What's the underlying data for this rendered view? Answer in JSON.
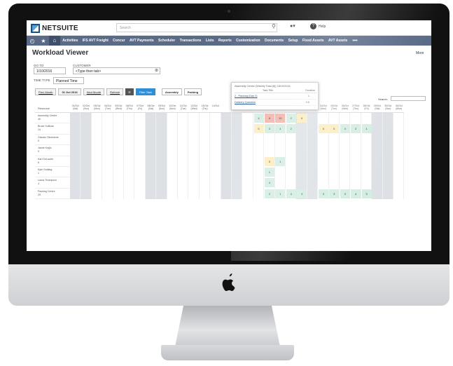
{
  "brand": {
    "name": "NETSUITE"
  },
  "search": {
    "placeholder": "Search"
  },
  "topbar": {
    "help": "Help"
  },
  "nav": {
    "items": [
      "Activities",
      "IFS AVT Freight",
      "Concur",
      "AVT Payments",
      "Scheduler",
      "Transactions",
      "Lists",
      "Reports",
      "Customization",
      "Documents",
      "Setup",
      "Fixed Assets",
      "AVT Assets"
    ],
    "more": "•••"
  },
  "page": {
    "title": "Workload Viewer",
    "more": "More"
  },
  "form": {
    "goto_label": "GO TO",
    "goto_value": "1/10/2016",
    "customer_label": "CUSTOMER",
    "customer_value": "<Type then tab>",
    "timetype_label": "TIME TYPE",
    "timetype_value": "Planned Time"
  },
  "toolbar": {
    "prev": "Prev Month",
    "current": "01 Oct 2016",
    "next": "Next Month",
    "refresh": "Refresh",
    "filter": "Filter Task",
    "assembly": "Assembly",
    "packing": "Packing"
  },
  "grid": {
    "search_label": "Search:",
    "resource_header": "Resource",
    "resources": [
      {
        "name": "Assembly Centre",
        "count": "40"
      },
      {
        "name": "Bruce Sullivan",
        "count": "14"
      },
      {
        "name": "Glaucio Silvestone",
        "count": "0"
      },
      {
        "name": "Jamie Krajic",
        "count": "0"
      },
      {
        "name": "Karl DeLauter",
        "count": "6"
      },
      {
        "name": "Kyle Golding",
        "count": "1"
      },
      {
        "name": "Laura Thompson",
        "count": "4"
      },
      {
        "name": "Packing Centre",
        "count": "25"
      }
    ],
    "days": [
      {
        "date": "01/Oct",
        "dow": "(Sat)"
      },
      {
        "date": "02/Oct",
        "dow": "(Sun)"
      },
      {
        "date": "03/Oct",
        "dow": "(Mon)"
      },
      {
        "date": "04/Oct",
        "dow": "(Tue)"
      },
      {
        "date": "05/Oct",
        "dow": "(Wed)"
      },
      {
        "date": "06/Oct",
        "dow": "(Thu)"
      },
      {
        "date": "07/Oct",
        "dow": "(Fri)"
      },
      {
        "date": "08/Oct",
        "dow": "(Sat)"
      },
      {
        "date": "09/Oct",
        "dow": "(Sun)"
      },
      {
        "date": "10/Oct",
        "dow": "(Mon)"
      },
      {
        "date": "11/Oct",
        "dow": "(Tue)"
      },
      {
        "date": "12/Oct",
        "dow": "(Wed)"
      },
      {
        "date": "13/Oct",
        "dow": "(Thu)"
      },
      {
        "date": "14/Oct",
        "dow": ""
      },
      {
        "date": "",
        "dow": ""
      },
      {
        "date": "",
        "dow": ""
      },
      {
        "date": "",
        "dow": ""
      },
      {
        "date": "",
        "dow": ""
      },
      {
        "date": "",
        "dow": ""
      },
      {
        "date": "",
        "dow": ""
      },
      {
        "date": "",
        "dow": ""
      },
      {
        "date": "22/Oct",
        "dow": "(Sat)"
      },
      {
        "date": "23/Oct",
        "dow": "(Sun)"
      },
      {
        "date": "24/Oct",
        "dow": "(Mon)"
      },
      {
        "date": "25/Oct",
        "dow": "(Tue)"
      },
      {
        "date": "26/Oct",
        "dow": "(Wed)"
      },
      {
        "date": "27/Oct",
        "dow": "(Thu)"
      },
      {
        "date": "28/Oct",
        "dow": "(Fri)"
      },
      {
        "date": "29/Oct",
        "dow": "(Sat)"
      },
      {
        "date": "30/Oct",
        "dow": "(Sun)"
      },
      {
        "date": "31/Oct",
        "dow": "(Mon)"
      }
    ],
    "cells": [
      {
        "row": 0,
        "col": 17,
        "v": "4",
        "c": "grn"
      },
      {
        "row": 0,
        "col": 18,
        "v": "8",
        "c": "red"
      },
      {
        "row": 0,
        "col": 19,
        "v": "10",
        "c": "red"
      },
      {
        "row": 0,
        "col": 20,
        "v": "2",
        "c": "grn"
      },
      {
        "row": 0,
        "col": 21,
        "v": "6",
        "c": "yel"
      },
      {
        "row": 1,
        "col": 17,
        "v": "5",
        "c": "yel"
      },
      {
        "row": 1,
        "col": 18,
        "v": "3",
        "c": "grn"
      },
      {
        "row": 1,
        "col": 19,
        "v": "4",
        "c": "grn"
      },
      {
        "row": 1,
        "col": 20,
        "v": "2",
        "c": "grn"
      },
      {
        "row": 1,
        "col": 23,
        "v": "5",
        "c": "yel"
      },
      {
        "row": 1,
        "col": 24,
        "v": "5",
        "c": "yel"
      },
      {
        "row": 1,
        "col": 25,
        "v": "4",
        "c": "grn"
      },
      {
        "row": 1,
        "col": 26,
        "v": "2",
        "c": "grn"
      },
      {
        "row": 1,
        "col": 27,
        "v": "1",
        "c": "grn"
      },
      {
        "row": 4,
        "col": 18,
        "v": "5",
        "c": "yel"
      },
      {
        "row": 4,
        "col": 19,
        "v": "1",
        "c": "grn"
      },
      {
        "row": 5,
        "col": 18,
        "v": "1",
        "c": "grn"
      },
      {
        "row": 6,
        "col": 18,
        "v": "4",
        "c": "grn"
      },
      {
        "row": 7,
        "col": 18,
        "v": "2",
        "c": "grn"
      },
      {
        "row": 7,
        "col": 19,
        "v": "1",
        "c": "grn"
      },
      {
        "row": 7,
        "col": 20,
        "v": "4",
        "c": "grn"
      },
      {
        "row": 7,
        "col": 21,
        "v": "3",
        "c": "grn"
      },
      {
        "row": 7,
        "col": 23,
        "v": "3",
        "c": "grn"
      },
      {
        "row": 7,
        "col": 24,
        "v": "3",
        "c": "grn"
      },
      {
        "row": 7,
        "col": 25,
        "v": "3",
        "c": "grn"
      },
      {
        "row": 7,
        "col": 26,
        "v": "4",
        "c": "grn"
      },
      {
        "row": 7,
        "col": 27,
        "v": "3",
        "c": "grn"
      }
    ],
    "weekend_cols": [
      0,
      1,
      7,
      8,
      14,
      15,
      21,
      22,
      28,
      29
    ]
  },
  "popup": {
    "title": "Assembly Centre (Weekly Total (8)) 18/10/2016",
    "col_task": "Task Title",
    "col_duration": "Duration",
    "rows": [
      {
        "task": "2 - Packing (Day 2)",
        "duration": "1"
      },
      {
        "task": "Delivery Question",
        "duration": "0.5"
      }
    ]
  },
  "colors": {
    "nav": "#5a6b88",
    "accent": "#2e8fd8",
    "red": "#f3b5ad",
    "yellow": "#fbedc0",
    "green": "#d3ede2"
  }
}
